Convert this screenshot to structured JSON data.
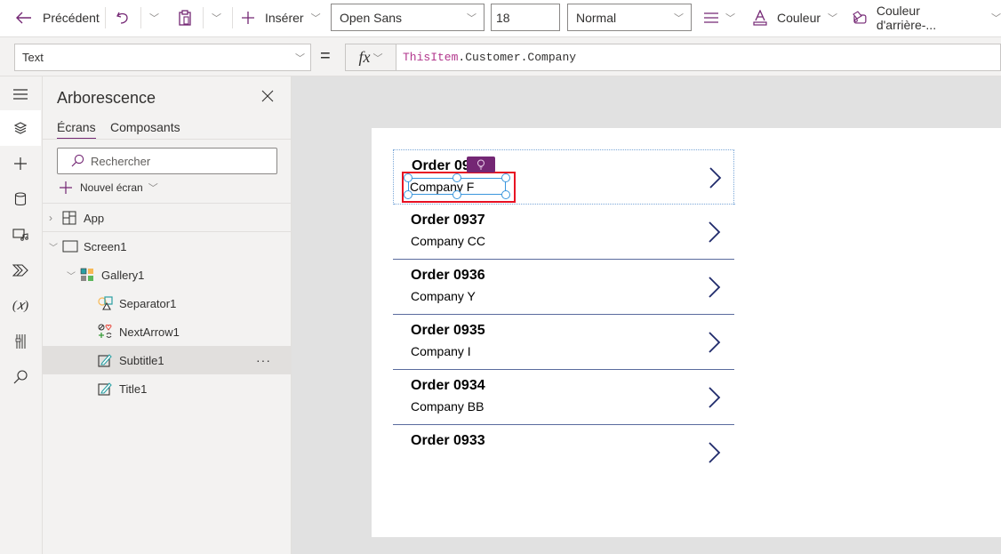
{
  "toolbar": {
    "back_label": "Précédent",
    "insert_label": "Insérer",
    "font_family": "Open Sans",
    "font_size": "18",
    "font_weight": "Normal",
    "color_label": "Couleur",
    "bg_color_label": "Couleur d'arrière-..."
  },
  "formula_bar": {
    "property": "Text",
    "equals": "=",
    "fx_label": "fx",
    "formula_keyword": "ThisItem",
    "formula_rest": ".Customer.Company"
  },
  "rail": {
    "icons": [
      "hamburger-icon",
      "layers-icon",
      "plus-icon",
      "database-icon",
      "media-icon",
      "power-automate-icon",
      "variables-icon",
      "tools-icon",
      "search-icon"
    ]
  },
  "tree": {
    "title": "Arborescence",
    "tabs": [
      {
        "label": "Écrans",
        "active": true
      },
      {
        "label": "Composants",
        "active": false
      }
    ],
    "search_placeholder": "Rechercher",
    "new_screen_label": "Nouvel écran",
    "items": [
      {
        "label": "App",
        "level": 0,
        "expander": "collapsed",
        "icon": "app-icon"
      },
      {
        "label": "Screen1",
        "level": 0,
        "expander": "expanded",
        "icon": "screen-icon"
      },
      {
        "label": "Gallery1",
        "level": 1,
        "expander": "expanded",
        "icon": "gallery-icon"
      },
      {
        "label": "Separator1",
        "level": 2,
        "icon": "shapes-icon"
      },
      {
        "label": "NextArrow1",
        "level": 2,
        "icon": "icons-icon"
      },
      {
        "label": "Subtitle1",
        "level": 2,
        "icon": "label-icon",
        "selected": true
      },
      {
        "label": "Title1",
        "level": 2,
        "icon": "label-icon"
      }
    ],
    "more_label": "···"
  },
  "gallery": {
    "rows": [
      {
        "title": "Order 09",
        "subtitle": "Company F"
      },
      {
        "title": "Order 0937",
        "subtitle": "Company CC"
      },
      {
        "title": "Order 0936",
        "subtitle": "Company Y"
      },
      {
        "title": "Order 0935",
        "subtitle": "Company I"
      },
      {
        "title": "Order 0934",
        "subtitle": "Company BB"
      },
      {
        "title": "Order 0933",
        "subtitle": ""
      }
    ]
  },
  "colors": {
    "accent": "#742774",
    "selection_red": "#e81123",
    "handle_blue": "#3a96dd",
    "arrow_navy": "#1f2a6b",
    "separator": "#5a6b9e"
  }
}
